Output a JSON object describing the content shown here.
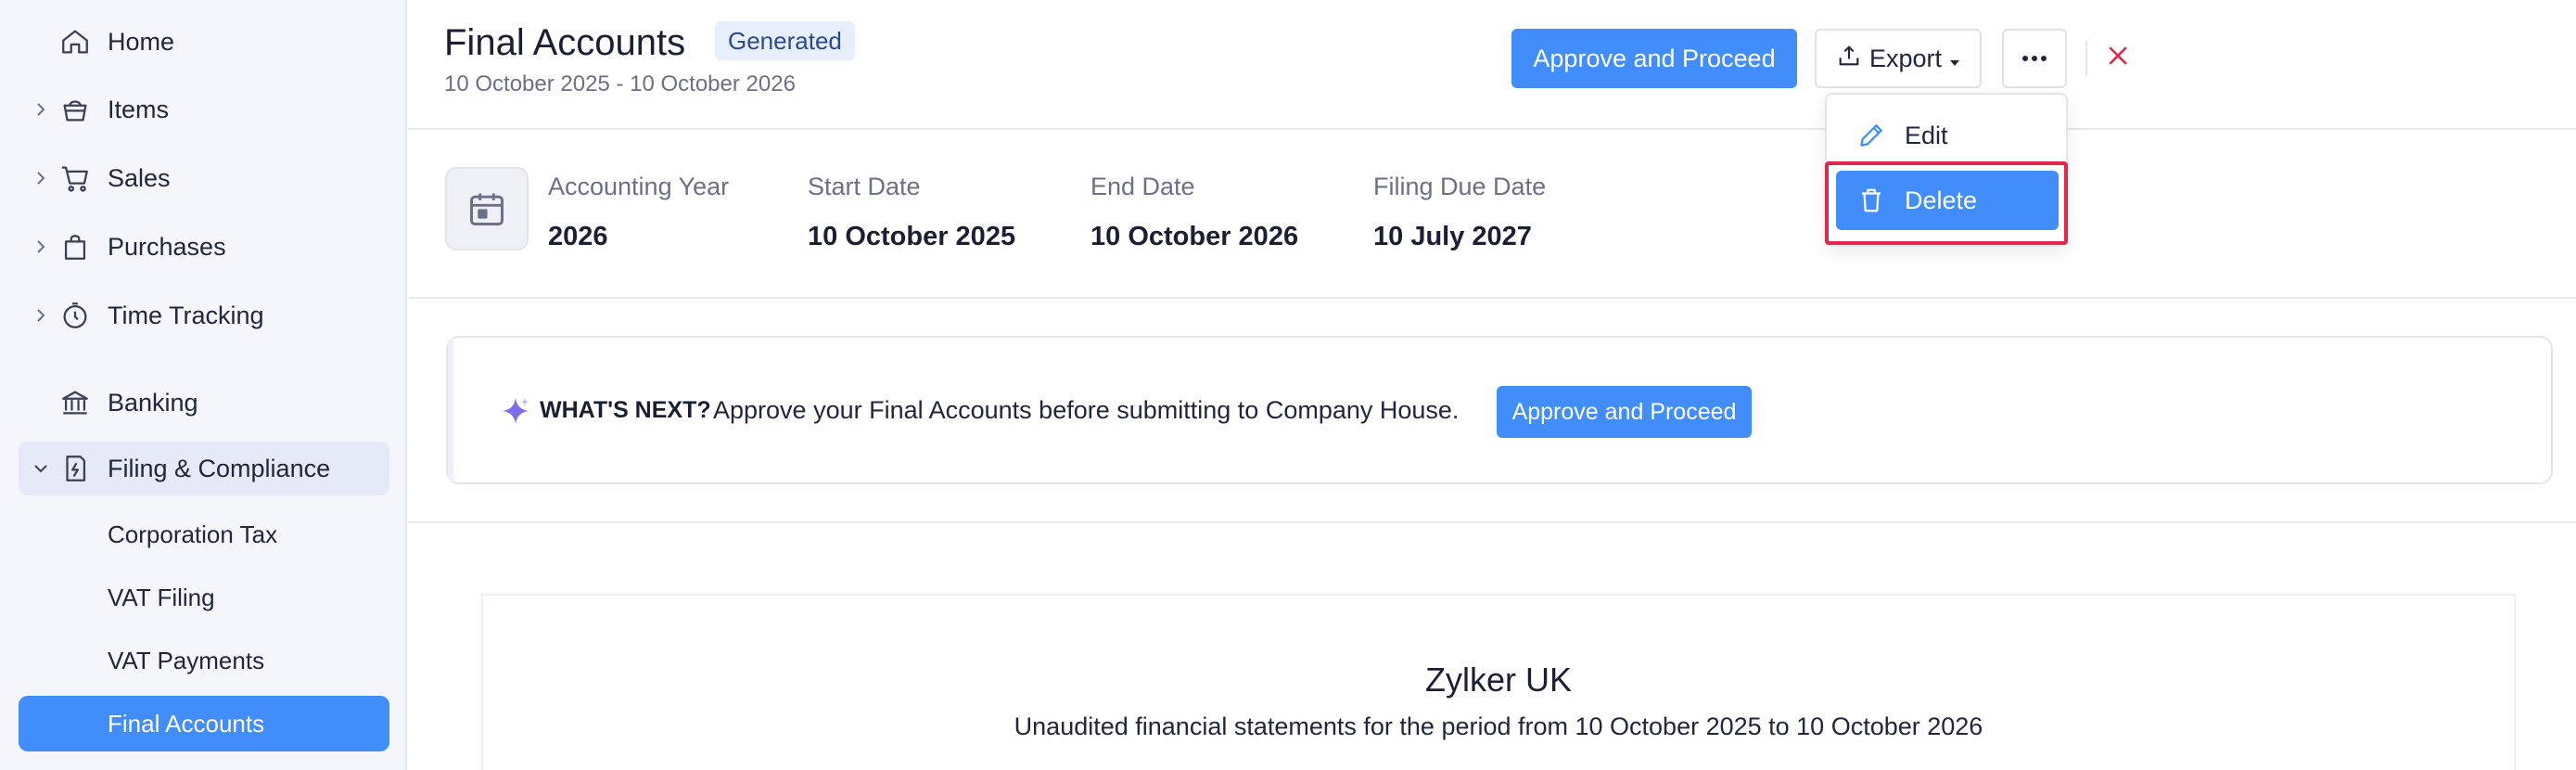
{
  "sidebar": {
    "items": [
      {
        "label": "Home",
        "icon": "home-icon"
      },
      {
        "label": "Items",
        "icon": "basket-icon"
      },
      {
        "label": "Sales",
        "icon": "cart-icon"
      },
      {
        "label": "Purchases",
        "icon": "bag-icon"
      },
      {
        "label": "Time Tracking",
        "icon": "stopwatch-icon"
      },
      {
        "label": "Banking",
        "icon": "bank-icon"
      },
      {
        "label": "Filing & Compliance",
        "icon": "compliance-icon"
      }
    ],
    "sub_items": [
      {
        "label": "Corporation Tax"
      },
      {
        "label": "VAT Filing"
      },
      {
        "label": "VAT Payments"
      },
      {
        "label": "Final Accounts"
      }
    ]
  },
  "header": {
    "title": "Final Accounts",
    "status": "Generated",
    "period": "10 October 2025 - 10 October 2026",
    "approve_label": "Approve and Proceed",
    "export_label": "Export"
  },
  "dropdown": {
    "edit_label": "Edit",
    "delete_label": "Delete"
  },
  "info": {
    "accounting_year_label": "Accounting Year",
    "accounting_year_value": "2026",
    "start_date_label": "Start Date",
    "start_date_value": "10 October 2025",
    "end_date_label": "End Date",
    "end_date_value": "10 October 2026",
    "filing_due_label": "Filing Due Date",
    "filing_due_value": "10 July 2027"
  },
  "whats_next": {
    "title": "WHAT'S NEXT?",
    "text": "Approve your Final Accounts before submitting to Company House.",
    "button_label": "Approve and Proceed"
  },
  "report": {
    "company": "Zylker UK",
    "subtitle": "Unaudited financial statements for the period from 10 October 2025 to 10 October 2026"
  },
  "colors": {
    "accent": "#408dfb",
    "highlight": "#e3264a",
    "close": "#e3264a"
  }
}
